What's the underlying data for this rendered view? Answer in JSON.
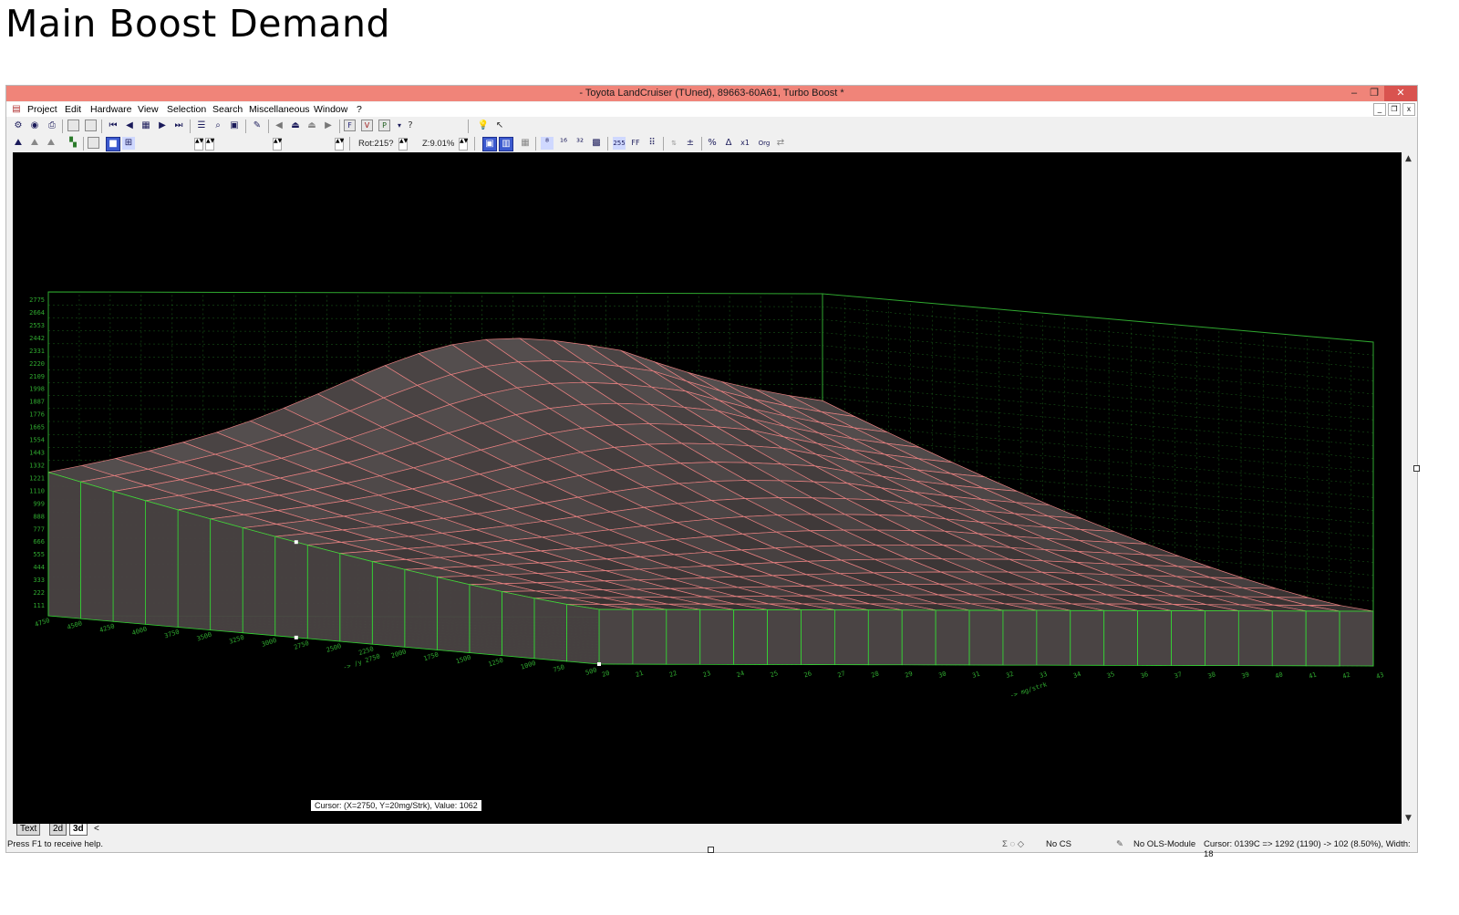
{
  "page": {
    "title": "Main Boost Demand"
  },
  "window": {
    "title": "- Toyota LandCruiser (TUned), 89663-60A61, Turbo Boost  *",
    "min_glyph": "–",
    "restore_glyph": "❐",
    "close_glyph": "✕"
  },
  "menu": {
    "items": [
      "Project",
      "Edit",
      "Hardware",
      "View",
      "Selection",
      "Search",
      "Miscellaneous",
      "Window",
      "?"
    ]
  },
  "toolbar": {
    "rotation_label": "Rot:215?",
    "zoom_label": "Z:9.01%",
    "help_glyph": "?",
    "hex_label": "255",
    "ff_label": "FF",
    "org_label": "Org",
    "percent_label": "%",
    "delta_label": "Δ",
    "x1_label": "x1"
  },
  "chart_axes": {
    "z_ticks": [
      "2775",
      "2664",
      "2553",
      "2442",
      "2331",
      "2220",
      "2109",
      "1998",
      "1887",
      "1776",
      "1665",
      "1554",
      "1443",
      "1332",
      "1221",
      "1110",
      "999",
      "888",
      "777",
      "666",
      "555",
      "444",
      "333",
      "222",
      "111"
    ],
    "y_ticks": [
      "4750",
      "4500",
      "4250",
      "4000",
      "3750",
      "3500",
      "3250",
      "3000",
      "2750",
      "2500",
      "2250",
      "2000",
      "1750",
      "1500",
      "1250",
      "1000",
      "750",
      "500"
    ],
    "x_ticks": [
      "20",
      "21",
      "22",
      "23",
      "24",
      "25",
      "26",
      "27",
      "28",
      "29",
      "30",
      "31",
      "32",
      "33",
      "34",
      "35",
      "36",
      "37",
      "38",
      "39",
      "40",
      "41",
      "42",
      "43"
    ],
    "y_axis_label": "-> /y 2750",
    "x_axis_label": "-> mg/strk"
  },
  "tabs": [
    "Text",
    "2d",
    "3d"
  ],
  "tab_arrow": "<",
  "cursor_tooltip": "Cursor: (X=2750, Y=20mg/Strk), Value: 1062",
  "status": {
    "help": "Press F1 to receive help.",
    "cs": "No CS",
    "ols": "No OLS-Module",
    "cursor": "Cursor: 0139C => 1292 (1190) -> 102 (8.50%), Width: 18"
  },
  "colors": {
    "background": "#000000",
    "grid": "#2fa82f",
    "mesh_lines": "#e88080",
    "front_lines": "#33dd33",
    "surface": "#4a4444",
    "titlebar": "#f08479"
  }
}
